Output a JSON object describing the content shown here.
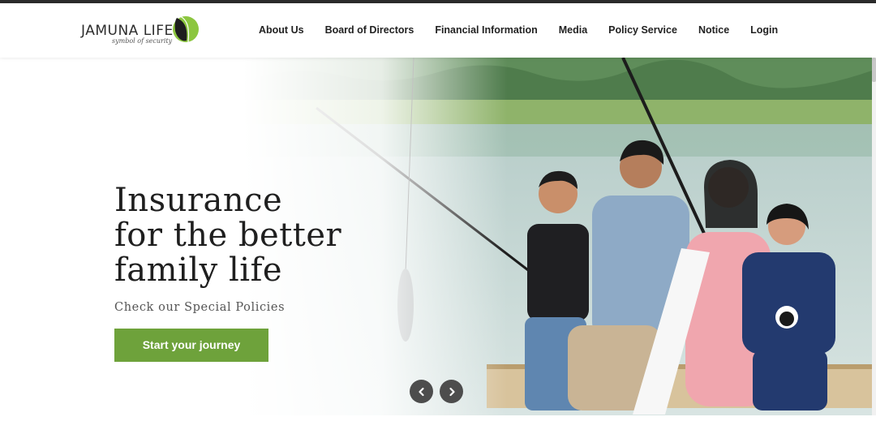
{
  "brand": {
    "name": "JAMUNA LIFE",
    "tagline": "symbol of security",
    "accent": "#6ea23b"
  },
  "nav": {
    "items": [
      {
        "label": "About Us"
      },
      {
        "label": "Board of Directors"
      },
      {
        "label": "Financial Information"
      },
      {
        "label": "Media"
      },
      {
        "label": "Policy Service"
      },
      {
        "label": "Notice"
      },
      {
        "label": "Login"
      }
    ]
  },
  "hero": {
    "title": "Insurance\nfor the better\nfamily life",
    "subtitle": "Check our Special Policies",
    "cta_label": "Start your journey",
    "image_icon": "family-fishing-photo",
    "prev_icon": "chevron-left-icon",
    "next_icon": "chevron-right-icon"
  }
}
